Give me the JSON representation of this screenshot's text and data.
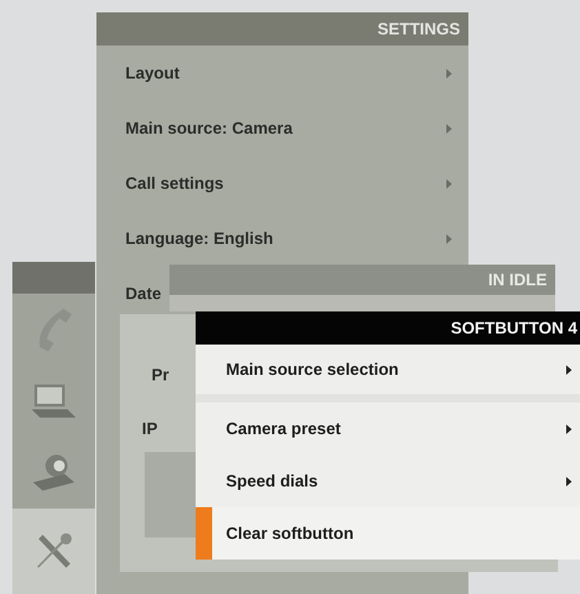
{
  "settings_menu": {
    "title": "SETTINGS",
    "items": [
      {
        "label": "Layout",
        "submenu": true
      },
      {
        "label": "Main source: Camera",
        "submenu": true
      },
      {
        "label": "Call settings",
        "submenu": true
      },
      {
        "label": "Language: English",
        "submenu": true
      },
      {
        "label": "Date"
      }
    ]
  },
  "sidebar": {
    "items": [
      {
        "kind": "phone",
        "selected": false
      },
      {
        "kind": "laptop",
        "selected": false
      },
      {
        "kind": "camera",
        "selected": false
      },
      {
        "kind": "tools",
        "selected": true
      }
    ]
  },
  "idle_panel": {
    "title": "IN IDLE",
    "labels": [
      "Pr",
      "IP"
    ]
  },
  "softbutton_menu": {
    "title": "SOFTBUTTON 4",
    "items": [
      {
        "label": "Main source selection",
        "submenu": true,
        "selected": false
      },
      {
        "label": "Camera preset",
        "submenu": true,
        "selected": false
      },
      {
        "label": "Speed dials",
        "submenu": true,
        "selected": false
      },
      {
        "label": "Clear softbutton",
        "submenu": false,
        "selected": true
      }
    ]
  }
}
